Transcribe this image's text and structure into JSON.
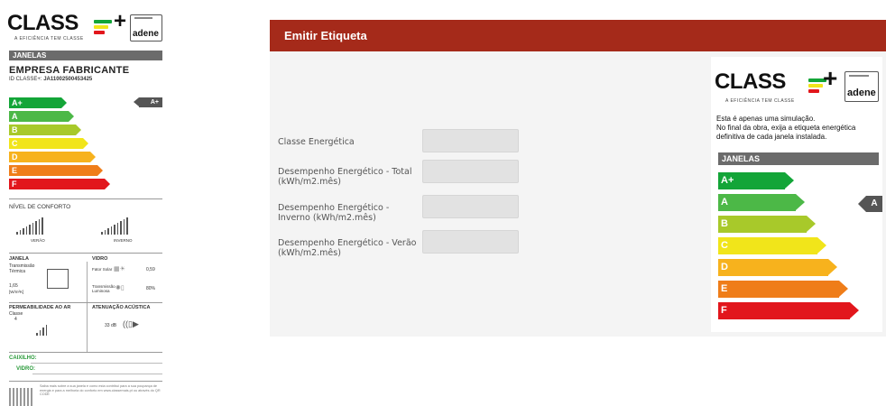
{
  "print_label": {
    "logo_word": "CLASS",
    "logo_plus": "+",
    "logo_tagline": "A EFICIÊNCIA TEM CLASSE",
    "adene": "adene",
    "category": "JANELAS",
    "manufacturer": "EMPRESA FABRICANTE",
    "code_prefix": "ID CLASSE+:",
    "code_value": "JA110025004534​25",
    "classes": [
      "A+",
      "A",
      "B",
      "C",
      "D",
      "E",
      "F"
    ],
    "class_colors": [
      "#13a538",
      "#4cb847",
      "#a8c92a",
      "#f1e51a",
      "#f7b21d",
      "#ef7d19",
      "#e2161c"
    ],
    "current_class": "A+",
    "comfort_title": "NÍVEL DE CONFORTO",
    "summer": "VERÃO",
    "winter": "INVERNO",
    "window_title": "JANELA",
    "window_transmission": "Transmissão Térmica",
    "window_u_value": "1,65",
    "window_unit": "[W/m²K]",
    "glass_title": "VIDRO",
    "solar_factor_label": "Fator Solar",
    "solar_factor_value": "0,59",
    "light_transmission_label": "Transmissão Luminosa",
    "light_transmission_value": "80%",
    "air_title": "PERMEABILIDADE AO AR",
    "air_class_label": "Classe",
    "air_class_value": "4",
    "acoustic_title": "ATENUAÇÃO ACÚSTICA",
    "acoustic_value": "33 dB",
    "frame_label": "CAIXILHO:",
    "glass_label": "VIDRO:",
    "footer_text": "Saiba mais sobre a sua janela e como esta contribui para a sua poupança de energia e para a melhoria do conforto em www.classemais.pt ou através do QR CODE"
  },
  "panel": {
    "title": "Emitir Etiqueta",
    "fields": [
      {
        "label": "Classe Energética",
        "value": ""
      },
      {
        "label": "Desempenho Energético - Total (kWh/m2.mês)",
        "value": ""
      },
      {
        "label": "Desempenho Energético - Inverno (kWh/m2.mês)",
        "value": ""
      },
      {
        "label": "Desempenho Energético - Verão (kWh/m2.mês)",
        "value": ""
      }
    ]
  },
  "sim_label": {
    "logo_word": "CLASS",
    "logo_plus": "+",
    "logo_tagline": "A EFICIÊNCIA TEM CLASSE",
    "adene": "adene",
    "note_lines": [
      "Esta é apenas uma simulação.",
      "No final da obra, exija a etiqueta energética",
      "definitiva de cada janela instalada."
    ],
    "category": "JANELAS",
    "classes": [
      "A+",
      "A",
      "B",
      "C",
      "D",
      "E",
      "F"
    ],
    "class_colors": [
      "#13a538",
      "#4cb847",
      "#a8c92a",
      "#f1e51a",
      "#f7b21d",
      "#ef7d19",
      "#e2161c"
    ],
    "current_class": "A"
  }
}
